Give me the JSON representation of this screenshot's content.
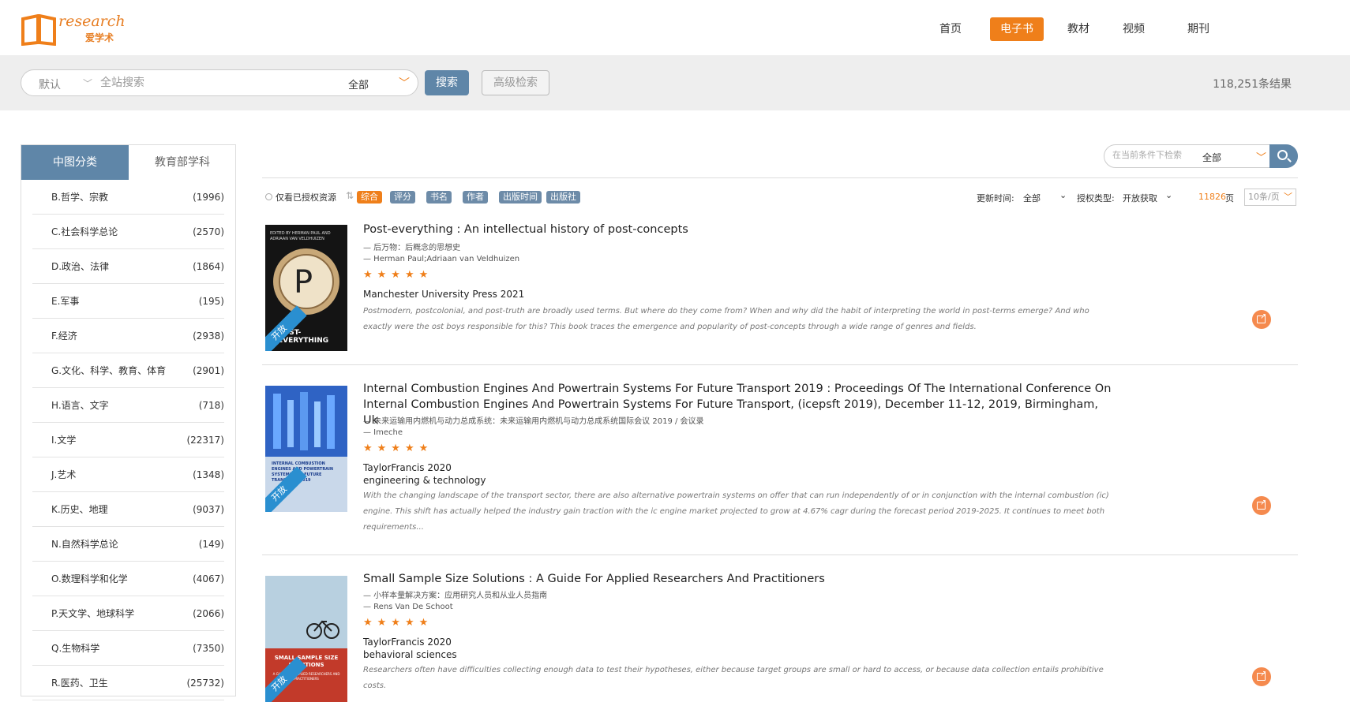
{
  "logo": {
    "text": "research",
    "sub": "爱学术"
  },
  "nav": [
    {
      "label": "首页",
      "active": false
    },
    {
      "label": "电子书",
      "active": true
    },
    {
      "label": "教材",
      "active": false
    },
    {
      "label": "视频",
      "active": false
    },
    {
      "label": "期刊",
      "active": false
    }
  ],
  "search": {
    "scope": "默认",
    "placeholder": "全站搜索",
    "category": "全部",
    "button": "搜索",
    "advanced": "高级检索",
    "result_count": "118,251条结果"
  },
  "sidebar": {
    "tab_active": "中图分类",
    "tab_other": "教育部学科",
    "categories": [
      {
        "name": "B.哲学、宗教",
        "count": "(1996)"
      },
      {
        "name": "C.社会科学总论",
        "count": "(2570)"
      },
      {
        "name": "D.政治、法律",
        "count": "(1864)"
      },
      {
        "name": "E.军事",
        "count": "(195)"
      },
      {
        "name": "F.经济",
        "count": "(2938)"
      },
      {
        "name": "G.文化、科学、教育、体育",
        "count": "(2901)"
      },
      {
        "name": "H.语言、文字",
        "count": "(718)"
      },
      {
        "name": "I.文学",
        "count": "(22317)"
      },
      {
        "name": "J.艺术",
        "count": "(1348)"
      },
      {
        "name": "K.历史、地理",
        "count": "(9037)"
      },
      {
        "name": "N.自然科学总论",
        "count": "(149)"
      },
      {
        "name": "O.数理科学和化学",
        "count": "(4067)"
      },
      {
        "name": "P.天文学、地球科学",
        "count": "(2066)"
      },
      {
        "name": "Q.生物科学",
        "count": "(7350)"
      },
      {
        "name": "R.医药、卫生",
        "count": "(25732)"
      }
    ]
  },
  "filter": {
    "placeholder": "在当前条件下检索",
    "category": "全部",
    "only_authorized": "仅看已授权资源",
    "sort_tags": [
      "综合",
      "评分",
      "书名",
      "作者",
      "出版时间",
      "出版社"
    ],
    "update_label": "更新时间:",
    "update_value": "全部",
    "license_label": "授权类型:",
    "license_value": "开放获取",
    "pages": "11826",
    "pages_unit": "页",
    "per_page": "10条/页"
  },
  "books": [
    {
      "title": "Post-everything : An intellectual history of post-concepts",
      "cn_title": "— 后万物：后概念的思想史",
      "authors": "— Herman Paul;Adriaan van Veldhuizen",
      "stars": "★★★★★",
      "publisher": "Manchester University Press 2021",
      "subject": "",
      "abstract": "Postmodern, postcolonial, and post-truth are broadly used terms. But where do they come from? When and why did the habit of interpreting the world in post-terms emerge? And who exactly were the ost boys responsible for this? This book traces the emergence and popularity of post-concepts through a wide range of genres and fields.",
      "ribbon": "开放",
      "cover_title": "POST-EVERYTHING",
      "cover_editors": "EDITED BY HERMAN PAUL AND ADRIAAN VAN VELDHUIZEN",
      "cover_letter": "P"
    },
    {
      "title": "Internal Combustion Engines And Powertrain Systems For Future Transport 2019 : Proceedings Of The International Conference On Internal Combustion Engines And Powertrain Systems For Future Transport, (icepsft 2019), December 11-12, 2019, Birmingham, Uk",
      "cn_title": "— 未来运输用内燃机与动力总成系统：未来运输用内燃机与动力总成系统国际会议 2019 / 会议录",
      "authors": "— Imeche",
      "stars": "★★★★★",
      "publisher": "TaylorFrancis 2020",
      "subject": "engineering & technology",
      "abstract": "With the changing landscape of the transport sector, there are also alternative powertrain systems on offer that can run independently of or in conjunction with the internal combustion (ic) engine. This shift has actually helped the industry gain traction with the ic engine market projected to grow at 4.67% cagr during the forecast period 2019-2025. It continues to meet both requirements...",
      "ribbon": "开放",
      "cover_title": "INTERNAL COMBUSTION ENGINES AND POWERTRAIN SYSTEMS FOR FUTURE TRANSPORT 2019",
      "cover_editors": "",
      "cover_letter": ""
    },
    {
      "title": "Small Sample Size Solutions : A Guide For Applied Researchers And Practitioners",
      "cn_title": "— 小样本量解决方案：应用研究人员和从业人员指南",
      "authors": "— Rens Van De Schoot",
      "stars": "★★★★★",
      "publisher": "TaylorFrancis 2020",
      "subject": "behavioral sciences",
      "abstract": "Researchers often have difficulties collecting enough data to test their hypotheses, either because target groups are small or hard to access, or because data collection entails prohibitive costs.",
      "ribbon": "开放",
      "cover_title": "SMALL SAMPLE SIZE SOLUTIONS",
      "cover_editors": "A GUIDE FOR APPLIED RESEARCHERS AND PRACTITIONERS",
      "cover_letter": ""
    }
  ],
  "colors": {
    "accent": "#ef7f1a",
    "primary": "#5f86a8",
    "ribbon": "#2a8fd0"
  }
}
